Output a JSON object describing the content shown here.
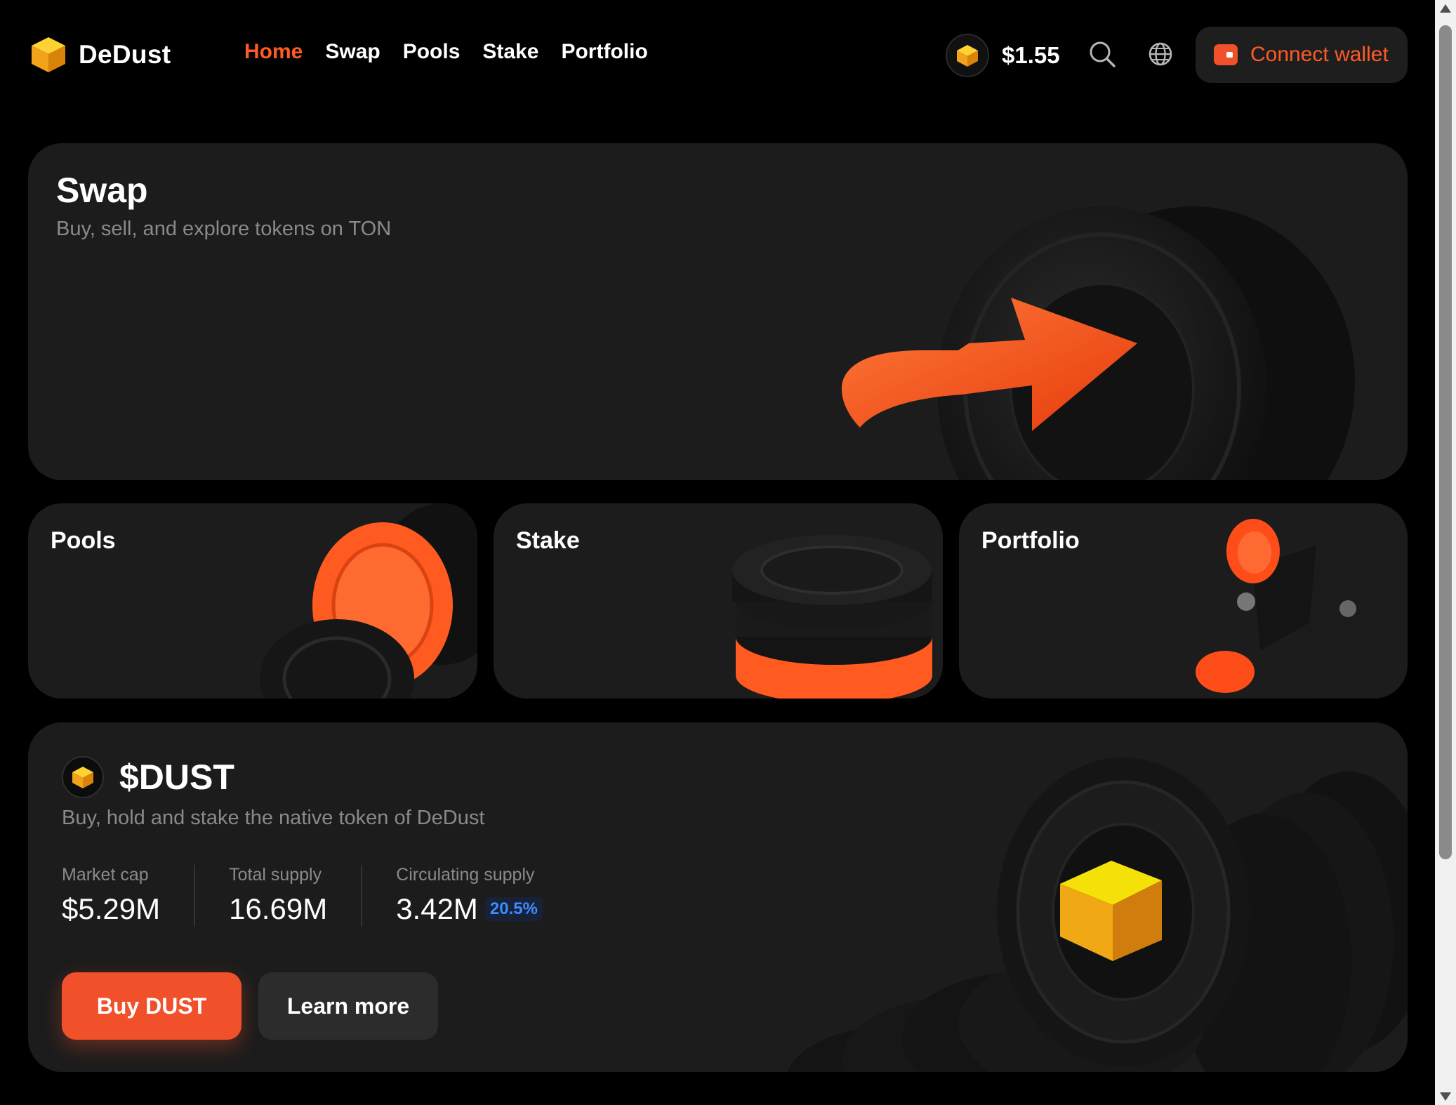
{
  "brand": {
    "name": "DeDust",
    "logo_icon": "cube-icon",
    "accent": "#ff5a26"
  },
  "nav": [
    {
      "label": "Home",
      "active": true
    },
    {
      "label": "Swap",
      "active": false
    },
    {
      "label": "Pools",
      "active": false
    },
    {
      "label": "Stake",
      "active": false
    },
    {
      "label": "Portfolio",
      "active": false
    }
  ],
  "header": {
    "price": "$1.55",
    "search_icon": "search-icon",
    "language_icon": "globe-icon",
    "connect_label": "Connect wallet"
  },
  "swap": {
    "title": "Swap",
    "subtitle": "Buy, sell, and explore tokens on TON"
  },
  "cards": [
    {
      "title": "Pools"
    },
    {
      "title": "Stake"
    },
    {
      "title": "Portfolio"
    }
  ],
  "dust": {
    "title": "$DUST",
    "subtitle": "Buy, hold and stake the native token of DeDust",
    "stats": [
      {
        "label": "Market cap",
        "value": "$5.29M"
      },
      {
        "label": "Total supply",
        "value": "16.69M"
      },
      {
        "label": "Circulating supply",
        "value": "3.42M",
        "badge": "20.5%"
      }
    ],
    "buy_label": "Buy DUST",
    "learn_label": "Learn more"
  }
}
